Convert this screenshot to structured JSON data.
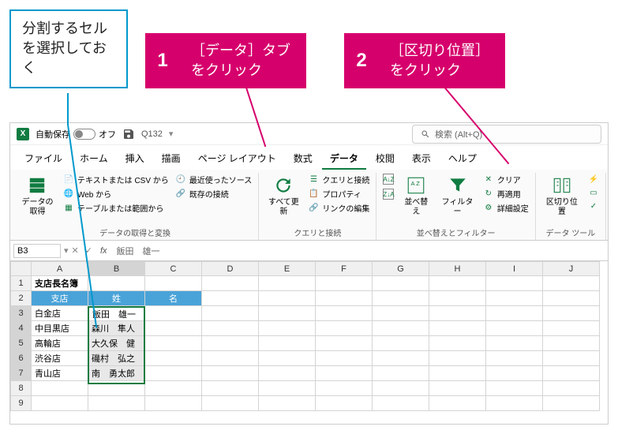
{
  "annotations": {
    "select": "分割するセルを選択しておく",
    "step1_num": "1",
    "step1_text": "［データ］タブをクリック",
    "step2_num": "2",
    "step2_text": "［区切り位置］をクリック"
  },
  "titlebar": {
    "autosave_label": "自動保存",
    "autosave_state": "オフ",
    "doc_name": "Q132",
    "search_placeholder": "検索 (Alt+Q)"
  },
  "tabs": {
    "file": "ファイル",
    "home": "ホーム",
    "insert": "挿入",
    "draw": "描画",
    "layout": "ページ レイアウト",
    "formulas": "数式",
    "data": "データ",
    "review": "校閲",
    "view": "表示",
    "help": "ヘルプ"
  },
  "ribbon": {
    "get_data": "データの取得",
    "from_csv": "テキストまたは CSV から",
    "from_web": "Web から",
    "from_table": "テーブルまたは範囲から",
    "recent": "最近使ったソース",
    "existing": "既存の接続",
    "group1_label": "データの取得と変換",
    "refresh_all": "すべて更新",
    "queries": "クエリと接続",
    "properties": "プロパティ",
    "edit_links": "リンクの編集",
    "group2_label": "クエリと接続",
    "sort": "並べ替え",
    "filter": "フィルター",
    "clear": "クリア",
    "reapply": "再適用",
    "advanced": "詳細設定",
    "group3_label": "並べ替えとフィルター",
    "text_to_columns": "区切り位置",
    "group4_label": "データ ツール"
  },
  "formula_bar": {
    "name_box": "B3",
    "formula": "飯田　雄一"
  },
  "grid": {
    "columns": [
      "A",
      "B",
      "C",
      "D",
      "E",
      "F",
      "G",
      "H",
      "I",
      "J"
    ],
    "rows": [
      "1",
      "2",
      "3",
      "4",
      "5",
      "6",
      "7",
      "8",
      "9"
    ],
    "a1": "支店長名簿",
    "headers": {
      "a2": "支店",
      "b2": "姓",
      "c2": "名"
    },
    "data": [
      {
        "a": "白金店",
        "b": "飯田　雄一"
      },
      {
        "a": "中目黒店",
        "b": "森川　隼人"
      },
      {
        "a": "高輪店",
        "b": "大久保　健"
      },
      {
        "a": "渋谷店",
        "b": "磯村　弘之"
      },
      {
        "a": "青山店",
        "b": "南　勇太郎"
      }
    ]
  },
  "colors": {
    "pink": "#d6006c",
    "blue": "#0099cc",
    "excel_green": "#107c41",
    "header_blue": "#4aa3d8"
  }
}
